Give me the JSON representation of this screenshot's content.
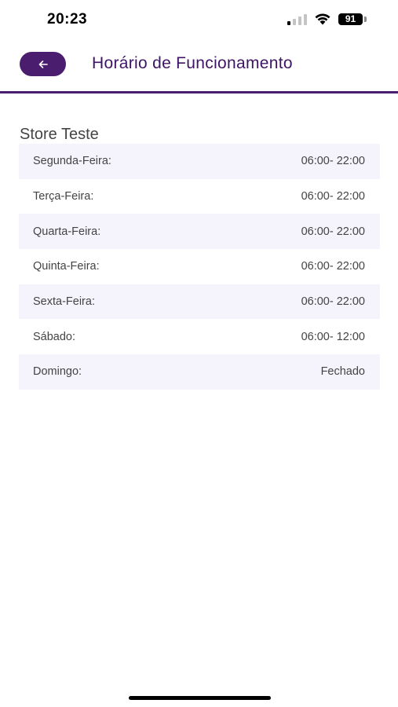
{
  "status_bar": {
    "time": "20:23",
    "battery": "91",
    "icons": [
      "signal-icon",
      "wifi-icon",
      "battery-icon"
    ]
  },
  "header": {
    "back_icon": "arrow-left-icon",
    "title": "Horário de Funcionamento"
  },
  "colors": {
    "accent": "#4a1d6e",
    "title": "#3f1466",
    "row_shade": "#f5f4fc"
  },
  "store": {
    "name": "Store Teste"
  },
  "hours": [
    {
      "day": "Segunda-Feira:",
      "time": "06:00- 22:00"
    },
    {
      "day": "Terça-Feira:",
      "time": "06:00- 22:00"
    },
    {
      "day": "Quarta-Feira:",
      "time": "06:00- 22:00"
    },
    {
      "day": "Quinta-Feira:",
      "time": "06:00- 22:00"
    },
    {
      "day": "Sexta-Feira:",
      "time": "06:00- 22:00"
    },
    {
      "day": "Sábado:",
      "time": "06:00- 12:00"
    },
    {
      "day": "Domingo:",
      "time": "Fechado"
    }
  ]
}
